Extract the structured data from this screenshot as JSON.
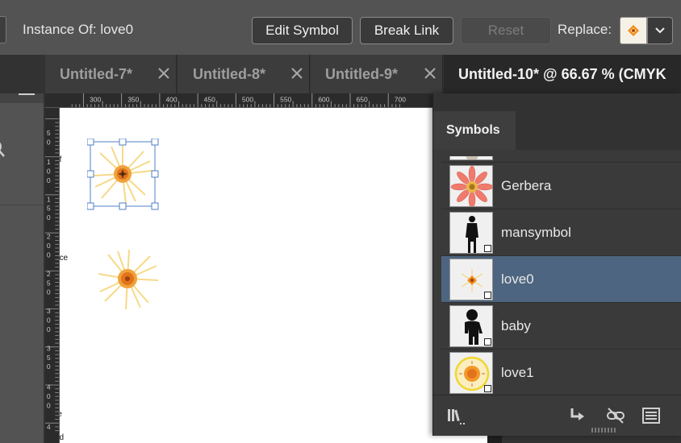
{
  "control_bar": {
    "instance_label": "Instance Of: love0",
    "edit_symbol_label": "Edit Symbol",
    "break_link_label": "Break Link",
    "reset_label": "Reset",
    "replace_label": "Replace:",
    "replace_icon": "flower-swatch-icon",
    "dropdown_icon": "chevron-down-icon"
  },
  "tabs": [
    {
      "label": "Untitled-7*",
      "active": false
    },
    {
      "label": "Untitled-8*",
      "active": false
    },
    {
      "label": "Untitled-9*",
      "active": false
    },
    {
      "label": "Untitled-10* @ 66.67 % (CMYK",
      "active": true
    }
  ],
  "ruler": {
    "horizontal": [
      "300",
      "350",
      "400",
      "450",
      "500",
      "550",
      "600",
      "650",
      "700"
    ],
    "vertical": [
      [
        "5",
        "0"
      ],
      [
        "1",
        "0",
        "0"
      ],
      [
        "1",
        "5",
        "0"
      ],
      [
        "2",
        "0",
        "0"
      ],
      [
        "2",
        "5",
        "0"
      ],
      [
        "3",
        "0",
        "0"
      ],
      [
        "3",
        "5",
        "0"
      ],
      [
        "4",
        "0",
        "0"
      ],
      [
        "4"
      ]
    ]
  },
  "canvas": {
    "fragments": [
      "of",
      "nce",
      "re",
      "ed"
    ]
  },
  "symbols_panel": {
    "title": "Symbols",
    "items": [
      {
        "name": "Gerbera",
        "selected": false,
        "icon": "gerbera-thumb"
      },
      {
        "name": "mansymbol",
        "selected": false,
        "icon": "man-silhouette-thumb"
      },
      {
        "name": "love0",
        "selected": true,
        "icon": "flower-burst-thumb"
      },
      {
        "name": "baby",
        "selected": false,
        "icon": "baby-silhouette-thumb"
      },
      {
        "name": "love1",
        "selected": false,
        "icon": "sun-burst-thumb"
      }
    ],
    "footer_icons": [
      "symbol-libraries-icon",
      "place-symbol-instance-icon",
      "break-link-icon",
      "symbol-options-icon"
    ]
  },
  "colors": {
    "selection": "#4d6580",
    "bounding_box": "#4f7fc9",
    "flower_center": "#e8731a",
    "flower_petal": "#f7d77a"
  }
}
